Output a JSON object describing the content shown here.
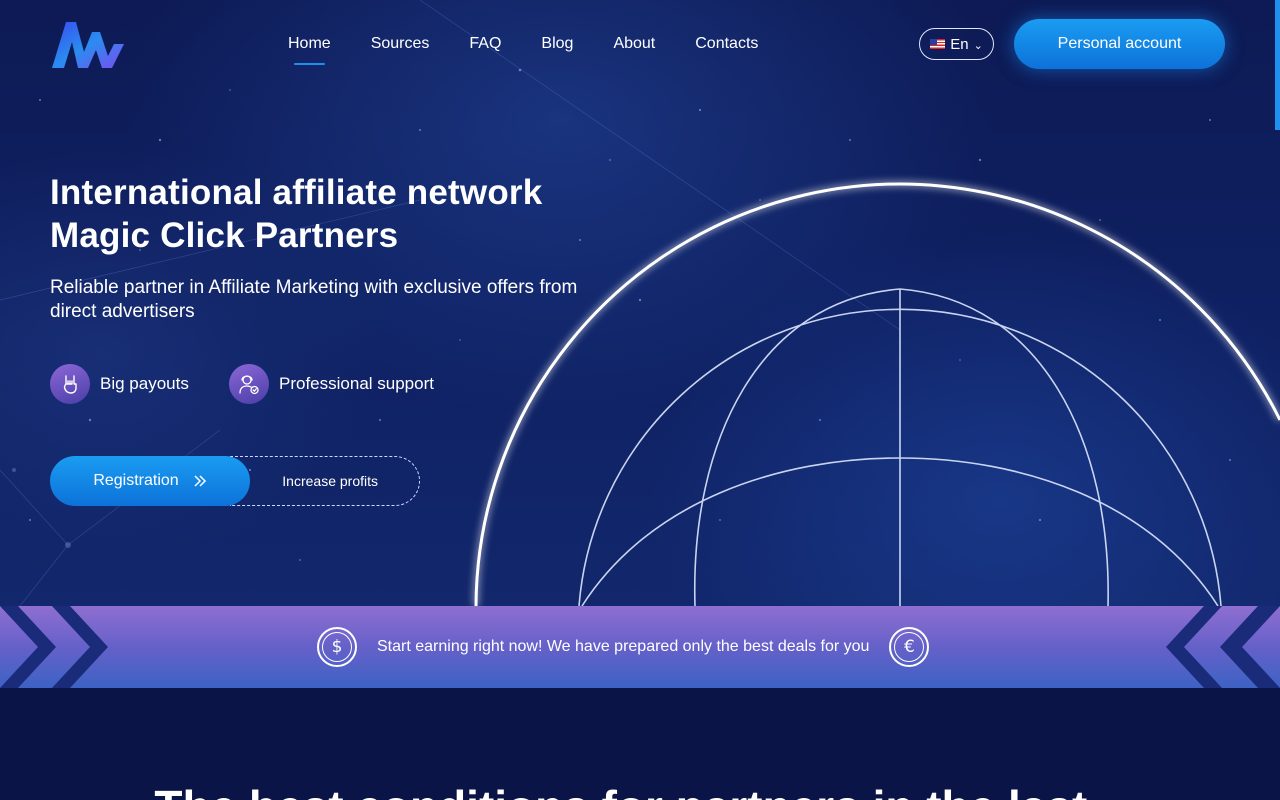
{
  "header": {
    "logo_alt": "Magic Click logo",
    "nav": [
      {
        "label": "Home",
        "active": true
      },
      {
        "label": "Sources",
        "active": false
      },
      {
        "label": "FAQ",
        "active": false
      },
      {
        "label": "Blog",
        "active": false
      },
      {
        "label": "About",
        "active": false
      },
      {
        "label": "Contacts",
        "active": false
      }
    ],
    "language": "En",
    "language_flag": "us-flag-icon",
    "account_button": "Personal account"
  },
  "hero": {
    "title_line1": "International affiliate network",
    "title_line2": "Magic Click Partners",
    "subtitle": "Reliable partner in Affiliate Marketing with exclusive offers from direct advertisers",
    "features": [
      {
        "icon": "rock-hand-icon",
        "label": "Big payouts"
      },
      {
        "icon": "support-agent-icon",
        "label": "Professional support"
      }
    ],
    "registration_button": "Registration",
    "increase_label": "Increase profits"
  },
  "banner": {
    "text": "Start earning right now! We have prepared only the best deals for you",
    "left_symbol": "$",
    "right_symbol": "€"
  },
  "section": {
    "heading": "The best conditions for partners in the last..."
  },
  "colors": {
    "accent": "#1a9cf2",
    "background": "#0b1447",
    "banner_top": "#8f6ed1",
    "banner_bottom": "#3d62c4"
  }
}
